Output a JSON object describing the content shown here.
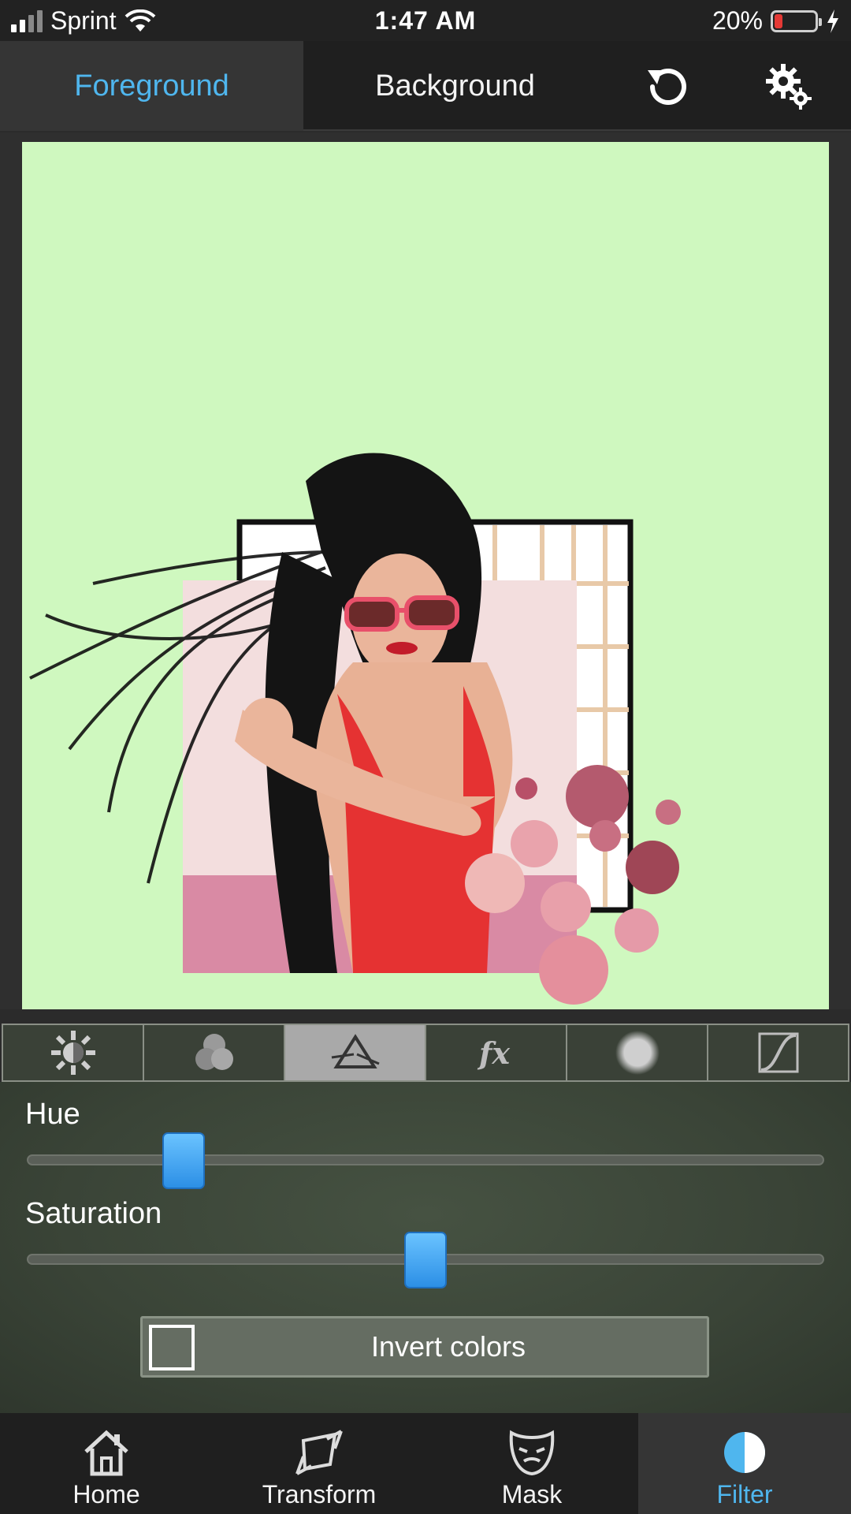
{
  "status": {
    "carrier": "Sprint",
    "time": "1:47 AM",
    "battery_percent_text": "20%",
    "battery_level": 0.2,
    "battery_color": "#e53935"
  },
  "top_tabs": {
    "foreground": "Foreground",
    "background": "Background",
    "undo_icon": "undo-icon",
    "settings_icon": "gear-icon",
    "active_color": "#4fb6ee"
  },
  "canvas": {
    "background_color": "#cff8bf"
  },
  "filter_tools": [
    {
      "icon": "brightness-icon"
    },
    {
      "icon": "rgb-channels-icon"
    },
    {
      "icon": "prism-icon",
      "active": true
    },
    {
      "icon": "fx-icon"
    },
    {
      "icon": "blur-icon"
    },
    {
      "icon": "curves-icon"
    }
  ],
  "adjustments": {
    "hue": {
      "label": "Hue",
      "value": 0.18
    },
    "saturation": {
      "label": "Saturation",
      "value": 0.5
    },
    "invert": {
      "label": "Invert colors",
      "checked": false
    }
  },
  "bottom_nav": {
    "home": "Home",
    "transform": "Transform",
    "mask": "Mask",
    "filter": "Filter",
    "active": "filter"
  }
}
